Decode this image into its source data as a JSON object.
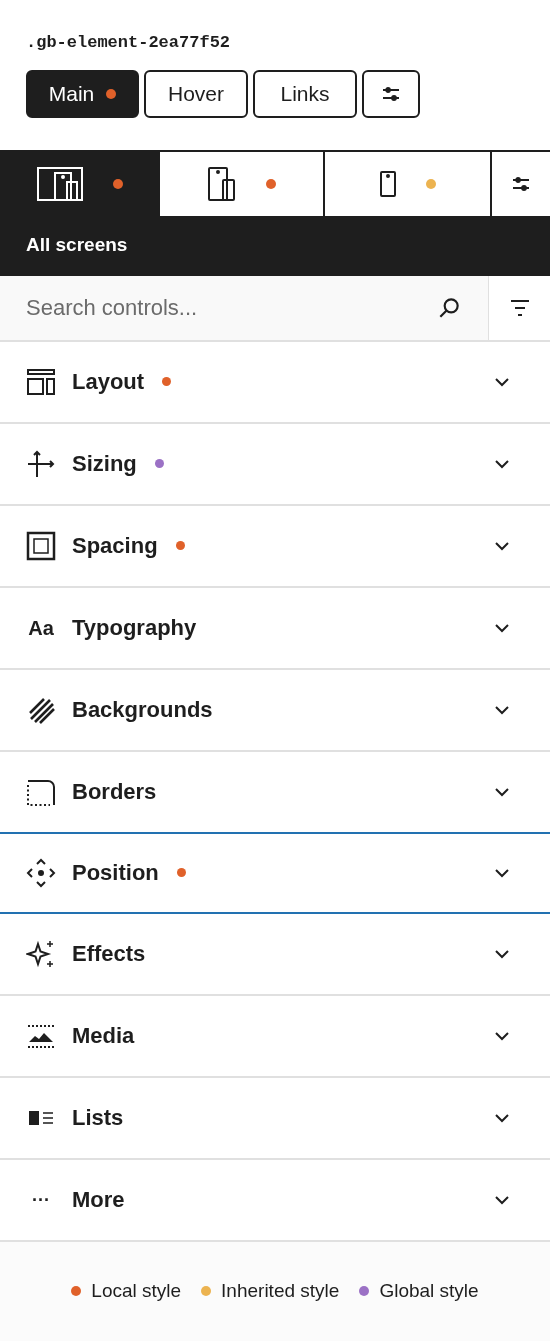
{
  "selector": ".gb-element-2ea77f52",
  "state_tabs": [
    {
      "kind": "text",
      "label": "Main",
      "selected": true,
      "color": "#e0612a"
    },
    {
      "kind": "text",
      "label": "Hover",
      "selected": false
    },
    {
      "kind": "text",
      "label": "Links",
      "selected": false
    },
    {
      "kind": "settings",
      "selected": false
    }
  ],
  "device_tabs": [
    {
      "kind": "desktop",
      "selected": true,
      "color": "#e0612a"
    },
    {
      "kind": "tablet",
      "selected": false,
      "color": "#e0612a"
    },
    {
      "kind": "mobile",
      "selected": false,
      "color": "#ecb350"
    },
    {
      "kind": "settings",
      "selected": false
    }
  ],
  "device_label": "All screens",
  "search": {
    "placeholder": "Search controls..."
  },
  "sections": [
    {
      "kind": "layout",
      "label": "Layout",
      "color": "#e0612a",
      "highlighted": false
    },
    {
      "kind": "sizing",
      "label": "Sizing",
      "color": "#9b71c5",
      "highlighted": false
    },
    {
      "kind": "spacing",
      "label": "Spacing",
      "color": "#e0612a",
      "highlighted": false
    },
    {
      "kind": "typography",
      "label": "Typography",
      "icon_text": "Aa",
      "highlighted": false
    },
    {
      "kind": "backgrounds",
      "label": "Backgrounds",
      "highlighted": false
    },
    {
      "kind": "borders",
      "label": "Borders",
      "highlighted": false
    },
    {
      "kind": "position",
      "label": "Position",
      "color": "#e0612a",
      "highlighted": true
    },
    {
      "kind": "effects",
      "label": "Effects",
      "highlighted": false
    },
    {
      "kind": "media",
      "label": "Media",
      "highlighted": false
    },
    {
      "kind": "lists",
      "label": "Lists",
      "highlighted": false
    },
    {
      "kind": "more",
      "label": "More",
      "icon_text": "···",
      "highlighted": false
    }
  ],
  "legend": [
    {
      "label": "Local style",
      "color": "#e0612a"
    },
    {
      "label": "Inherited style",
      "color": "#ecb350"
    },
    {
      "label": "Global style",
      "color": "#9b71c5"
    }
  ]
}
